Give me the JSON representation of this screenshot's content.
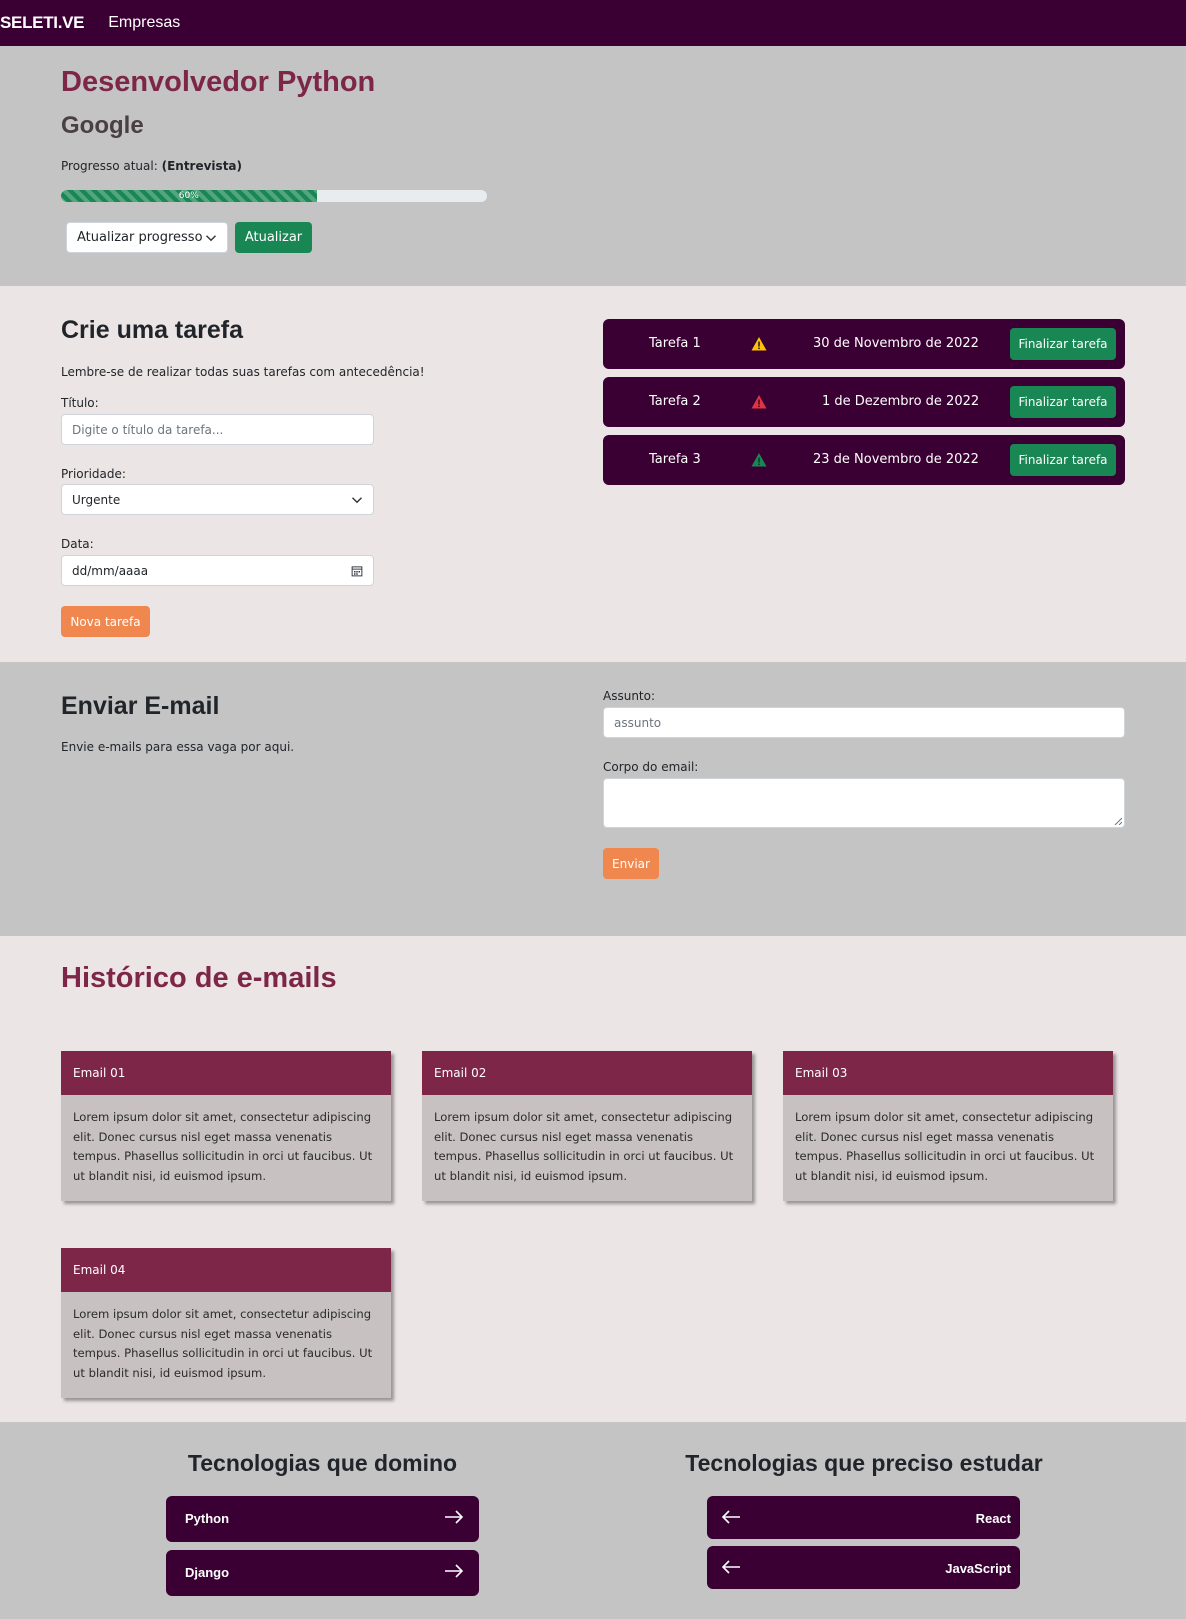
{
  "navbar": {
    "brand": "SELETI.VE",
    "link": "Empresas"
  },
  "job": {
    "title": "Desenvolvedor Python",
    "company": "Google",
    "progress_label": "Progresso atual:",
    "progress_stage": "(Entrevista)",
    "progress_percent": 60,
    "progress_text": "60%",
    "select_value": "Atualizar progresso",
    "update_button": "Atualizar"
  },
  "task_form": {
    "heading": "Crie uma tarefa",
    "subtitle": "Lembre-se de realizar todas suas tarefas com antecedência!",
    "title_label": "Título:",
    "title_placeholder": "Digite o título da tarefa...",
    "priority_label": "Prioridade:",
    "priority_value": "Urgente",
    "date_label": "Data:",
    "date_value": "dd/mm/aaaa",
    "submit": "Nova tarefa"
  },
  "tasks": [
    {
      "name": "Tarefa 1",
      "priority_icon": "warning-yellow-icon",
      "date": "30 de Novembro de 2022",
      "button": "Finalizar tarefa"
    },
    {
      "name": "Tarefa 2",
      "priority_icon": "warning-red-icon",
      "date": "1 de Dezembro de 2022",
      "button": "Finalizar tarefa"
    },
    {
      "name": "Tarefa 3",
      "priority_icon": "warning-green-icon",
      "date": "23 de Novembro de 2022",
      "button": "Finalizar tarefa"
    }
  ],
  "email_form": {
    "heading": "Enviar E-mail",
    "subtitle": "Envie e-mails para essa vaga por aqui.",
    "subject_label": "Assunto:",
    "subject_placeholder": "assunto",
    "body_label": "Corpo do email:",
    "submit": "Enviar"
  },
  "history": {
    "heading": "Histórico de e-mails",
    "emails": [
      {
        "title": "Email 01",
        "body": "Lorem ipsum dolor sit amet, consectetur adipiscing elit. Donec cursus nisl eget massa venenatis tempus. Phasellus sollicitudin in orci ut faucibus. Ut ut blandit nisi, id euismod ipsum."
      },
      {
        "title": "Email 02",
        "body": "Lorem ipsum dolor sit amet, consectetur adipiscing elit. Donec cursus nisl eget massa venenatis tempus. Phasellus sollicitudin in orci ut faucibus. Ut ut blandit nisi, id euismod ipsum."
      },
      {
        "title": "Email 03",
        "body": "Lorem ipsum dolor sit amet, consectetur adipiscing elit. Donec cursus nisl eget massa venenatis tempus. Phasellus sollicitudin in orci ut faucibus. Ut ut blandit nisi, id euismod ipsum."
      },
      {
        "title": "Email 04",
        "body": "Lorem ipsum dolor sit amet, consectetur adipiscing elit. Donec cursus nisl eget massa venenatis tempus. Phasellus sollicitudin in orci ut faucibus. Ut ut blandit nisi, id euismod ipsum."
      }
    ]
  },
  "tech": {
    "known_heading": "Tecnologias que domino",
    "known": [
      "Python",
      "Django"
    ],
    "study_heading": "Tecnologias que preciso estudar",
    "study": [
      "React",
      "JavaScript"
    ]
  },
  "colors": {
    "primary_dark": "#3b0033",
    "accent_wine": "#7d2647",
    "success": "#198754",
    "orange": "#f0874f",
    "gray_bg": "#c4c4c4",
    "light_bg": "#ebe5e6"
  }
}
